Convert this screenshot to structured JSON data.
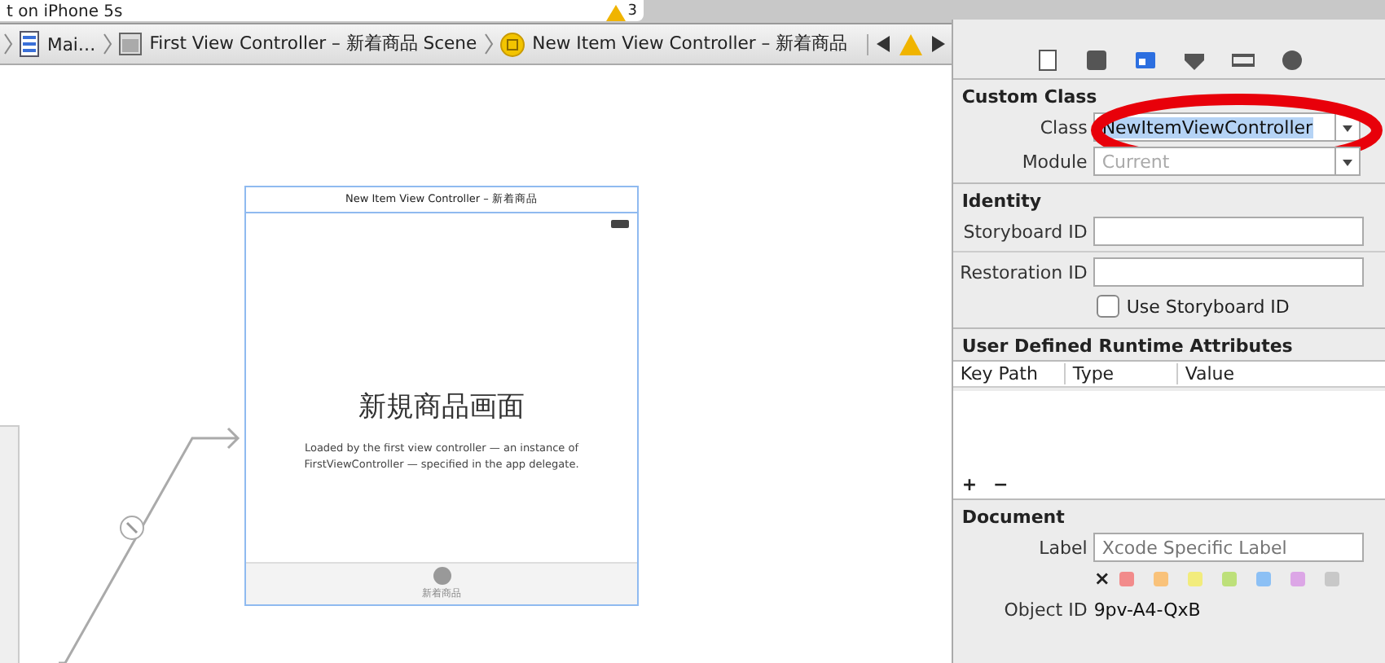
{
  "top_bar": {
    "scheme_text": "t on iPhone 5s",
    "warning_count": "3"
  },
  "breadcrumbs": [
    {
      "kind": "storyboard",
      "label": "Mai…"
    },
    {
      "kind": "scene",
      "label": "First View Controller – 新着商品 Scene"
    },
    {
      "kind": "controller",
      "label": "New Item View Controller – 新着商品"
    }
  ],
  "canvas": {
    "scene": {
      "title": "New Item View Controller – 新着商品",
      "heading": "新規商品画面",
      "description": "Loaded by the first view controller — an instance of FirstViewController — specified in the app delegate.",
      "tab_label": "新着商品"
    }
  },
  "inspector": {
    "tabs": [
      {
        "kind": "file",
        "selected": false
      },
      {
        "kind": "quick-help",
        "selected": false
      },
      {
        "kind": "identity",
        "selected": true
      },
      {
        "kind": "attributes",
        "selected": false
      },
      {
        "kind": "size",
        "selected": false
      },
      {
        "kind": "connections",
        "selected": false
      }
    ],
    "custom_class": {
      "title": "Custom Class",
      "class_label": "Class",
      "class_value": "NewItemViewController",
      "module_label": "Module",
      "module_value": "Current"
    },
    "identity": {
      "title": "Identity",
      "storyboard_id_label": "Storyboard ID",
      "restoration_id_label": "Restoration ID",
      "use_storyboard_id": {
        "label": "Use Storyboard ID",
        "checked": false
      }
    },
    "runtime_attributes": {
      "title": "User Defined Runtime Attributes",
      "columns": [
        "Key Path",
        "Type",
        "Value"
      ],
      "add": "+",
      "remove": "−"
    },
    "document": {
      "title": "Document",
      "label_label": "Label",
      "label_placeholder": "Xcode Specific Label",
      "clear": "×",
      "colors": [
        {
          "color": "#f28b8b"
        },
        {
          "color": "#f9c27a"
        },
        {
          "color": "#f2ec7c"
        },
        {
          "color": "#bde07a"
        },
        {
          "color": "#8cc0f5"
        },
        {
          "color": "#dca6e6"
        },
        {
          "color": "#c8c8c8"
        }
      ],
      "object_id_label": "Object ID",
      "object_id": "9pv-A4-QxB"
    }
  }
}
